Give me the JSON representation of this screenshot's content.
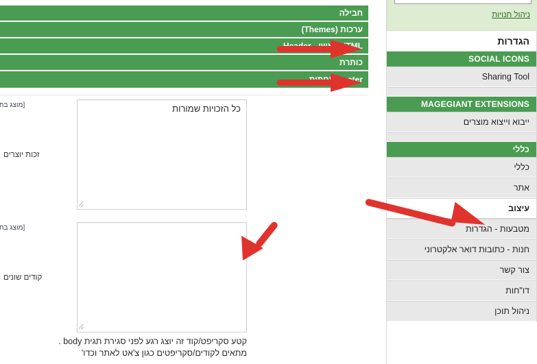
{
  "main": {
    "green_bars": [
      {
        "label": "חבילה"
      },
      {
        "label": "ערכות (Themes)"
      },
      {
        "label": "HTML ראשי - Header"
      },
      {
        "label": "כותרת"
      },
      {
        "label": "Footer תחתית"
      }
    ],
    "fields": [
      {
        "label": "זכות יוצרים",
        "value": "כל הזכויות שמורות",
        "hint": "[מוצג בחנות ללא"
      },
      {
        "label": "קודים שונים",
        "value": "",
        "hint": "[מוצג בחנות ללא"
      }
    ],
    "helper_lines": [
      "קטע סקריפט/קוד זה יוצג רגע לפני סגירת תגית body .",
      "מתאים לקודים/סקריפטים כגון צ'אט לאתר וכדו'"
    ]
  },
  "sidebar": {
    "store_manage_link": "ניהול חנויות",
    "title": "הגדרות",
    "sections": [
      {
        "group": "SOCIAL ICONS",
        "items": [
          {
            "label": "Sharing Tool",
            "active": false,
            "blank": false
          },
          {
            "label": "",
            "active": false,
            "blank": true
          }
        ]
      },
      {
        "group": "MAGEGIANT EXTENSIONS",
        "items": [
          {
            "label": "ייבוא וייצוא מוצרים",
            "active": false,
            "blank": false
          },
          {
            "label": "",
            "active": false,
            "blank": true
          }
        ]
      },
      {
        "group": "כללי",
        "items": [
          {
            "label": "כללי",
            "active": false,
            "blank": false
          },
          {
            "label": "אתר",
            "active": false,
            "blank": false
          },
          {
            "label": "עיצוב",
            "active": true,
            "blank": false
          },
          {
            "label": "מטבעות - הגדרות",
            "active": false,
            "blank": false
          },
          {
            "label": "חנות - כתובות דואר אלקטרוני",
            "active": false,
            "blank": false
          },
          {
            "label": "צור קשר",
            "active": false,
            "blank": false
          },
          {
            "label": "דו\"חות",
            "active": false,
            "blank": false
          },
          {
            "label": "ניהול תוכן",
            "active": false,
            "blank": false
          }
        ]
      }
    ]
  },
  "annotations": {
    "arrows": [
      {
        "name": "arrow-html-header"
      },
      {
        "name": "arrow-footer"
      },
      {
        "name": "arrow-design-menu"
      },
      {
        "name": "arrow-codes-textarea"
      }
    ]
  },
  "colors": {
    "green": "#4a9c52",
    "light_green_panel": "#deecd2",
    "sidebar_item": "#e8e8e8",
    "arrow_red": "#e0332e",
    "link_green": "#2d6a1f"
  }
}
